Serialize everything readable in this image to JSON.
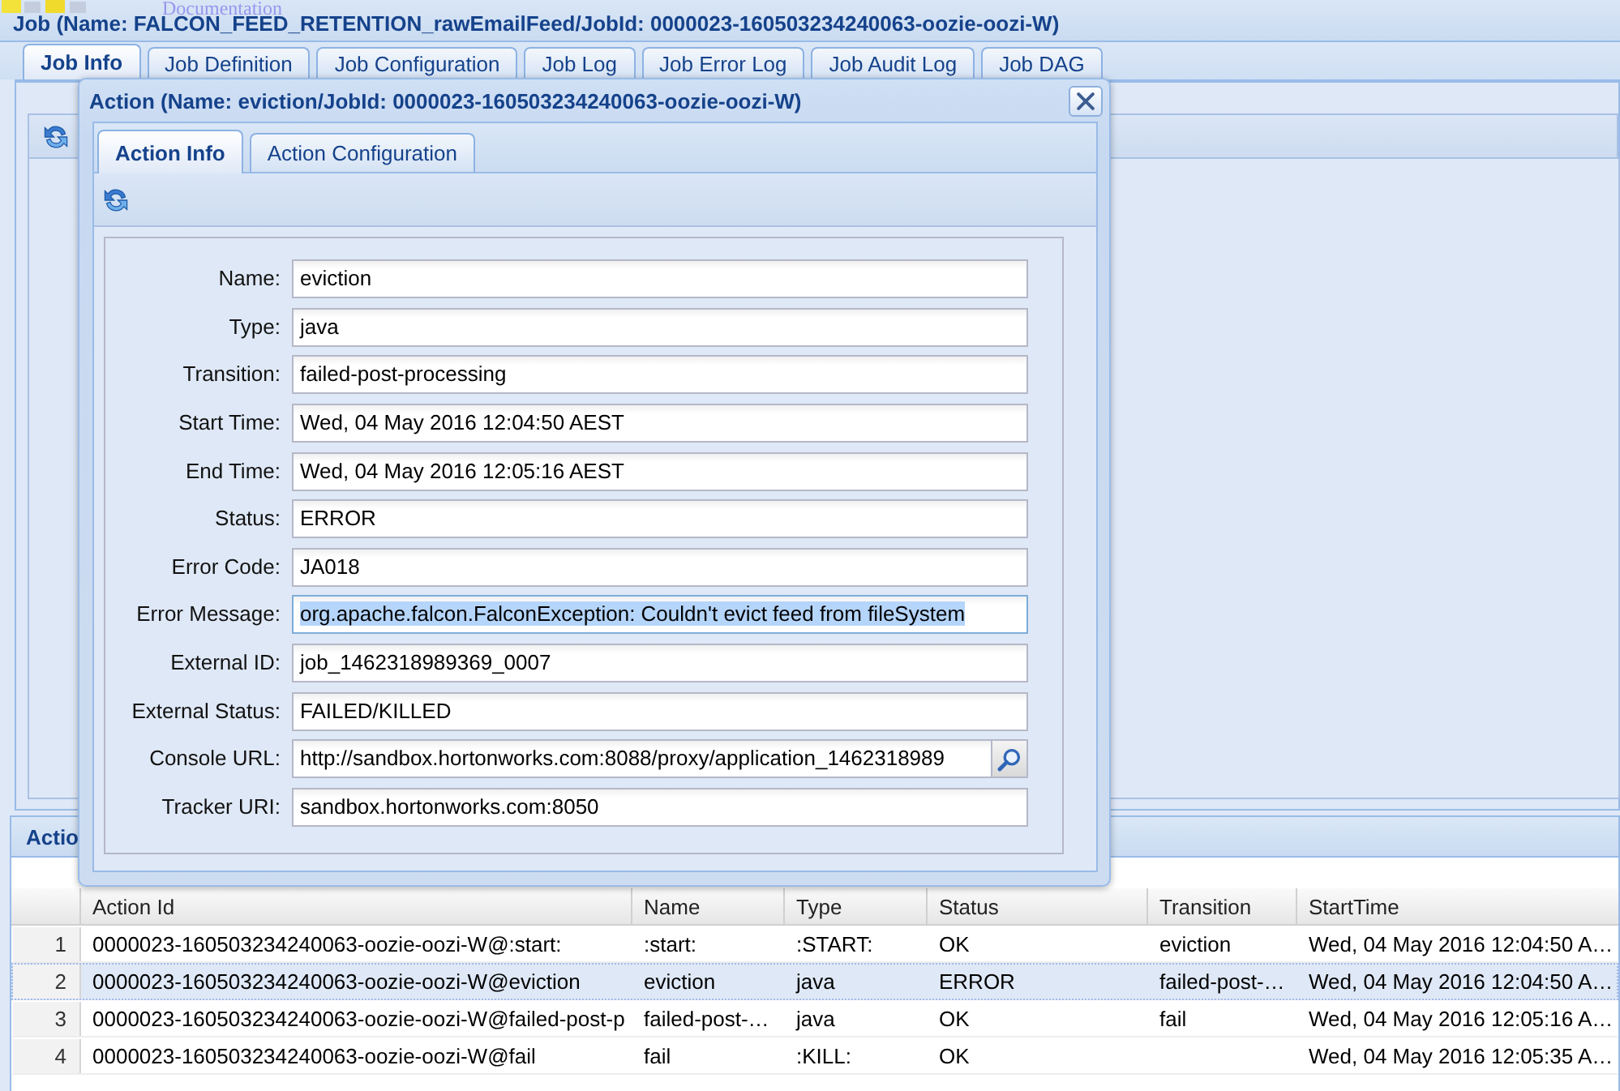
{
  "page_header": {
    "link": "Documentation"
  },
  "job_window": {
    "title": "Job (Name: FALCON_FEED_RETENTION_rawEmailFeed/JobId: 0000023-160503234240063-oozie-oozi-W)",
    "tabs": [
      {
        "label": "Job Info",
        "selected": true
      },
      {
        "label": "Job Definition",
        "selected": false
      },
      {
        "label": "Job Configuration",
        "selected": false
      },
      {
        "label": "Job Log",
        "selected": false
      },
      {
        "label": "Job Error Log",
        "selected": false
      },
      {
        "label": "Job Audit Log",
        "selected": false
      },
      {
        "label": "Job DAG",
        "selected": false
      }
    ]
  },
  "actions_panel": {
    "title": "Actio",
    "columns": [
      "Action Id",
      "Name",
      "Type",
      "Status",
      "Transition",
      "StartTime"
    ],
    "rows": [
      {
        "number": "1",
        "cells": [
          "0000023-160503234240063-oozie-oozi-W@:start:",
          ":start:",
          ":START:",
          "OK",
          "eviction",
          "Wed, 04 May 2016 12:04:50 A…"
        ],
        "selected": false
      },
      {
        "number": "2",
        "cells": [
          "0000023-160503234240063-oozie-oozi-W@eviction",
          "eviction",
          "java",
          "ERROR",
          "failed-post-…",
          "Wed, 04 May 2016 12:04:50 A…"
        ],
        "selected": true
      },
      {
        "number": "3",
        "cells": [
          "0000023-160503234240063-oozie-oozi-W@failed-post-p",
          "failed-post-…",
          "java",
          "OK",
          "fail",
          "Wed, 04 May 2016 12:05:16 A…"
        ],
        "selected": false
      },
      {
        "number": "4",
        "cells": [
          "0000023-160503234240063-oozie-oozi-W@fail",
          "fail",
          ":KILL:",
          "OK",
          null,
          "Wed, 04 May 2016 12:05:35 A…"
        ],
        "selected": false
      }
    ]
  },
  "action_window": {
    "title": "Action (Name: eviction/JobId: 0000023-160503234240063-oozie-oozi-W)",
    "tabs": [
      {
        "label": "Action Info",
        "selected": true
      },
      {
        "label": "Action Configuration",
        "selected": false
      }
    ],
    "fields": [
      {
        "label": "Name:",
        "value": "eviction",
        "kind": "text",
        "highlighted": false
      },
      {
        "label": "Type:",
        "value": "java",
        "kind": "text",
        "highlighted": false
      },
      {
        "label": "Transition:",
        "value": "failed-post-processing",
        "kind": "text",
        "highlighted": false
      },
      {
        "label": "Start Time:",
        "value": "Wed, 04 May 2016 12:04:50 AEST",
        "kind": "text",
        "highlighted": false
      },
      {
        "label": "End Time:",
        "value": "Wed, 04 May 2016 12:05:16 AEST",
        "kind": "text",
        "highlighted": false
      },
      {
        "label": "Status:",
        "value": "ERROR",
        "kind": "text",
        "highlighted": false
      },
      {
        "label": "Error Code:",
        "value": "JA018",
        "kind": "text",
        "highlighted": false
      },
      {
        "label": "Error Message:",
        "value": "org.apache.falcon.FalconException: Couldn't evict feed from fileSystem",
        "kind": "text",
        "highlighted": true
      },
      {
        "label": "External ID:",
        "value": "job_1462318989369_0007",
        "kind": "text",
        "highlighted": false
      },
      {
        "label": "External Status:",
        "value": "FAILED/KILLED",
        "kind": "text",
        "highlighted": false
      },
      {
        "label": "Console URL:",
        "value": "http://sandbox.hortonworks.com:8088/proxy/application_1462318989",
        "kind": "lookup",
        "highlighted": false
      },
      {
        "label": "Tracker URI:",
        "value": "sandbox.hortonworks.com:8050",
        "kind": "text",
        "highlighted": false
      }
    ]
  }
}
